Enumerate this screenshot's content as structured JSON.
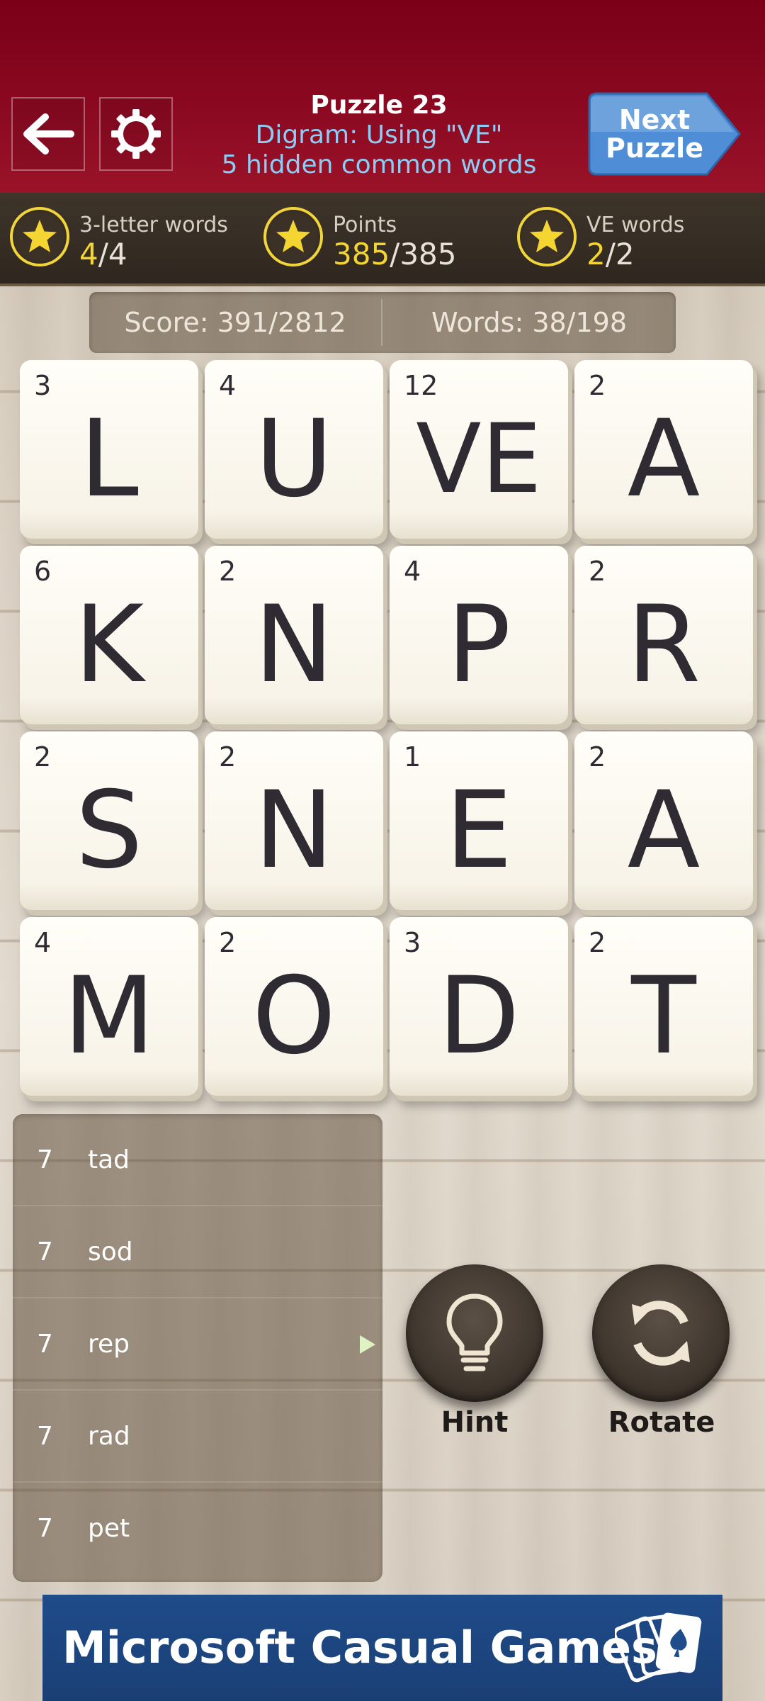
{
  "header": {
    "title": "Puzzle 23",
    "subtitle_1": "Digram: Using \"VE\"",
    "subtitle_2": "5 hidden common words",
    "next_button": "Next\nPuzzle",
    "back_icon": "back-arrow-icon",
    "settings_icon": "gear-icon"
  },
  "achievements": [
    {
      "label": "3-letter words",
      "current": "4",
      "total": "/4",
      "icon": "star-icon"
    },
    {
      "label": "Points",
      "current": "385",
      "total": "/385",
      "icon": "star-icon"
    },
    {
      "label": "VE words",
      "current": "2",
      "total": "/2",
      "icon": "star-icon"
    }
  ],
  "score": {
    "score_text": "Score: 391/2812",
    "words_text": "Words: 38/198"
  },
  "board": [
    {
      "points": "3",
      "letter": "L"
    },
    {
      "points": "4",
      "letter": "U"
    },
    {
      "points": "12",
      "letter": "VE"
    },
    {
      "points": "2",
      "letter": "A"
    },
    {
      "points": "6",
      "letter": "K"
    },
    {
      "points": "2",
      "letter": "N"
    },
    {
      "points": "4",
      "letter": "P"
    },
    {
      "points": "2",
      "letter": "R"
    },
    {
      "points": "2",
      "letter": "S"
    },
    {
      "points": "2",
      "letter": "N"
    },
    {
      "points": "1",
      "letter": "E"
    },
    {
      "points": "2",
      "letter": "A"
    },
    {
      "points": "4",
      "letter": "M"
    },
    {
      "points": "2",
      "letter": "O"
    },
    {
      "points": "3",
      "letter": "D"
    },
    {
      "points": "2",
      "letter": "T"
    }
  ],
  "found_words": [
    {
      "points": "7",
      "word": "tad"
    },
    {
      "points": "7",
      "word": "sod"
    },
    {
      "points": "7",
      "word": "rep"
    },
    {
      "points": "7",
      "word": "rad"
    },
    {
      "points": "7",
      "word": "pet"
    }
  ],
  "controls": {
    "hint_label": "Hint",
    "hint_icon": "lightbulb-icon",
    "rotate_label": "Rotate",
    "rotate_icon": "rotate-icon"
  },
  "banner": {
    "text": "Microsoft Casual Games",
    "icon": "playing-cards-icon"
  },
  "colors": {
    "header_red": "#8c0a22",
    "accent_yellow": "#f4d532",
    "subtitle_blue": "#8ccdf6",
    "next_button_blue": "#4f8ed6",
    "banner_blue": "#1f4c8a"
  }
}
